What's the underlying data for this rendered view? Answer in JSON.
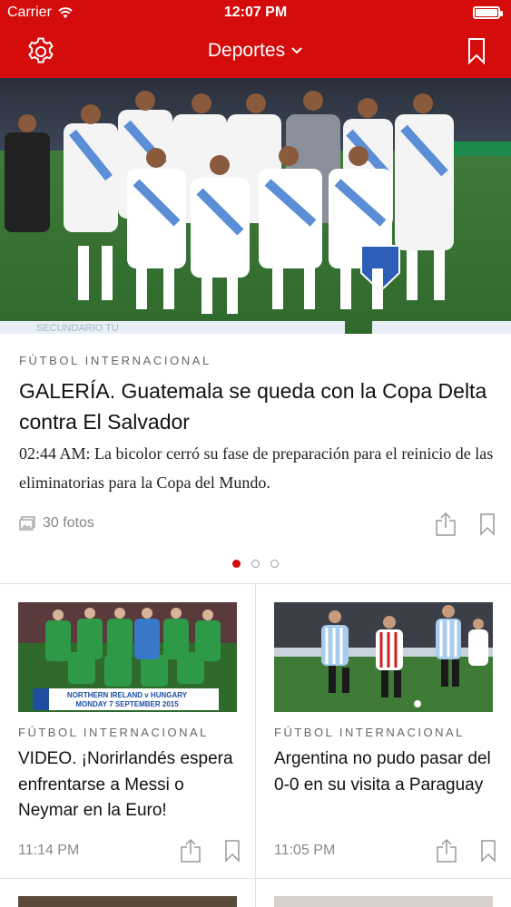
{
  "status_bar": {
    "carrier": "Carrier",
    "time": "12:07 PM"
  },
  "nav": {
    "title": "Deportes",
    "chevron": "chevron-down-icon",
    "left_icon": "gear-icon",
    "right_icon": "bookmark-icon"
  },
  "featured": {
    "category": "FÚTBOL INTERNACIONAL",
    "title": "GALERÍA. Guatemala se queda con la Copa Delta contra El Salvador",
    "summary": "02:44 AM: La bicolor cerró su fase de preparación para el reinicio de las eliminatorias para la Copa del Mundo.",
    "photos_label": "30 fotos",
    "hero_banner_text": "SECUNDARIO TU"
  },
  "pager": {
    "total": 3,
    "active": 0
  },
  "cards": [
    {
      "category": "FÚTBOL INTERNACIONAL",
      "title": "VIDEO. ¡Norirlandés espera enfrentarse a Messi o Neymar en la Euro!",
      "time": "11:14 PM",
      "banner_line1": "NORTHERN IRELAND v HUNGARY",
      "banner_line2": "MONDAY 7 SEPTEMBER 2015"
    },
    {
      "category": "FÚTBOL INTERNACIONAL",
      "title": "Argentina no pudo pasar del 0-0 en su visita a Paraguay",
      "time": "11:05 PM"
    }
  ],
  "colors": {
    "brand_red": "#d50c0c",
    "muted": "#888888"
  }
}
